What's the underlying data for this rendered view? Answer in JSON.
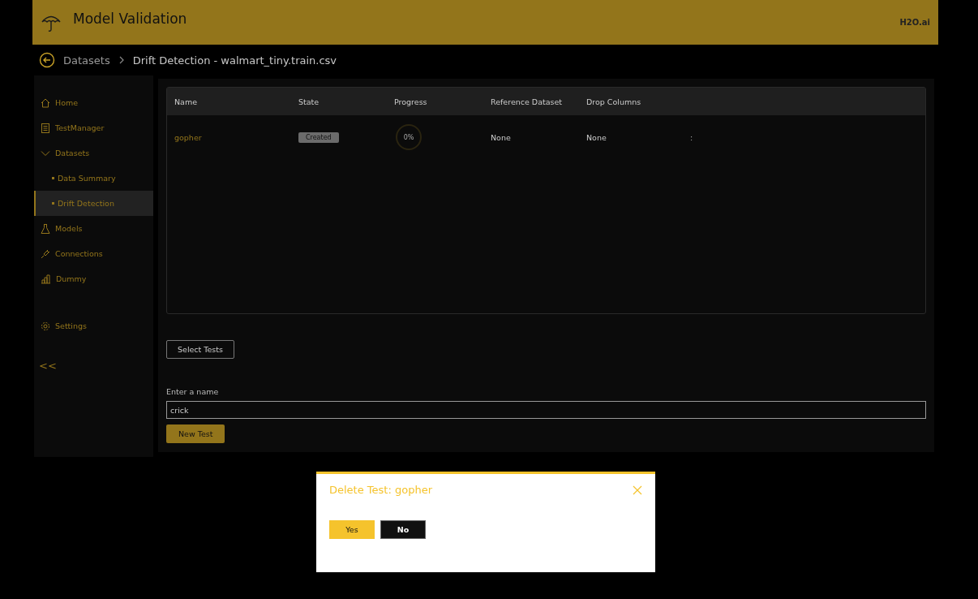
{
  "header": {
    "title": "Model Validation",
    "brand": "H2O.ai"
  },
  "breadcrumb": {
    "parent": "Datasets",
    "current": "Drift Detection - walmart_tiny.train.csv"
  },
  "sidebar": {
    "items": [
      {
        "label": "Home",
        "kind": "home",
        "selected": false
      },
      {
        "label": "TestManager",
        "kind": "list",
        "selected": false
      },
      {
        "label": "Datasets",
        "kind": "group",
        "selected": false,
        "expanded": true,
        "children": [
          {
            "label": "Data Summary",
            "selected": false
          },
          {
            "label": "Drift Detection",
            "selected": true
          }
        ]
      },
      {
        "label": "Models",
        "kind": "flask",
        "selected": false
      },
      {
        "label": "Connections",
        "kind": "plug",
        "selected": false
      },
      {
        "label": "Dummy",
        "kind": "chart",
        "selected": false
      },
      {
        "label": "Settings",
        "kind": "settings",
        "selected": false
      }
    ],
    "collapse": "<<"
  },
  "table": {
    "columns": [
      "Name",
      "State",
      "Progress",
      "Reference Dataset",
      "Drop Columns"
    ],
    "rows": [
      {
        "name": "gopher",
        "state": "Created",
        "progress": "0%",
        "reference": "None",
        "drop": "None",
        "more": ":"
      }
    ]
  },
  "select_button": "Select Tests",
  "name_field": {
    "label": "Enter a name",
    "value": "crick"
  },
  "new_button": "New Test",
  "dialog": {
    "title": "Delete Test: gopher",
    "buttons": [
      "Yes",
      "No"
    ]
  }
}
